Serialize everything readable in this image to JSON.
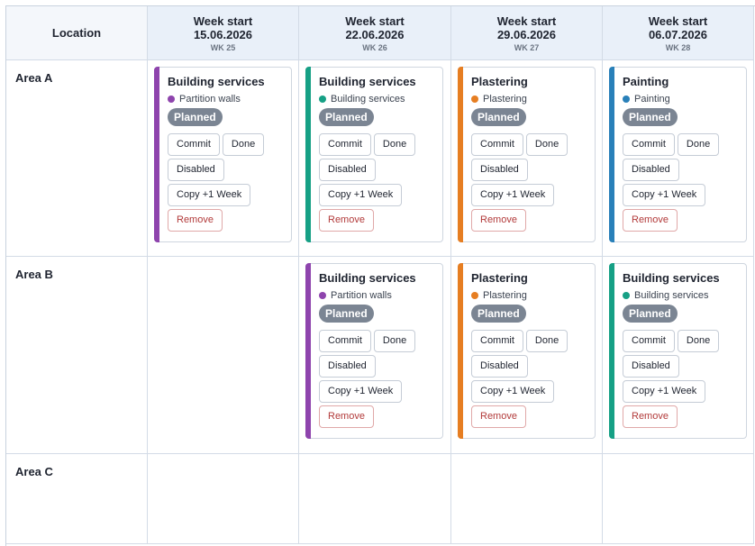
{
  "header": {
    "location_label": "Location",
    "weeks": [
      {
        "title": "Week start",
        "date": "15.06.2026",
        "code": "WK 25"
      },
      {
        "title": "Week start",
        "date": "22.06.2026",
        "code": "WK 26"
      },
      {
        "title": "Week start",
        "date": "29.06.2026",
        "code": "WK 27"
      },
      {
        "title": "Week start",
        "date": "06.07.2026",
        "code": "WK 28"
      }
    ]
  },
  "areas": [
    {
      "name": "Area A"
    },
    {
      "name": "Area B"
    },
    {
      "name": "Area C"
    }
  ],
  "buttons": {
    "commit": "Commit",
    "done": "Done",
    "disabled": "Disabled",
    "copy": "Copy +1 Week",
    "remove": "Remove"
  },
  "colors": {
    "purple": "#8e44ad",
    "teal": "#16a085",
    "orange": "#e67e22",
    "blue": "#2980b9",
    "status_planned": "#7b8593"
  },
  "cards": {
    "a0": {
      "title": "Building services",
      "trade": "Partition walls",
      "status": "Planned",
      "color": "#8e44ad"
    },
    "a1": {
      "title": "Building services",
      "trade": "Building services",
      "status": "Planned",
      "color": "#16a085"
    },
    "a2": {
      "title": "Plastering",
      "trade": "Plastering",
      "status": "Planned",
      "color": "#e67e22"
    },
    "a3": {
      "title": "Painting",
      "trade": "Painting",
      "status": "Planned",
      "color": "#2980b9"
    },
    "b1": {
      "title": "Building services",
      "trade": "Partition walls",
      "status": "Planned",
      "color": "#8e44ad"
    },
    "b2": {
      "title": "Plastering",
      "trade": "Plastering",
      "status": "Planned",
      "color": "#e67e22"
    },
    "b3": {
      "title": "Building services",
      "trade": "Building services",
      "status": "Planned",
      "color": "#16a085"
    }
  }
}
